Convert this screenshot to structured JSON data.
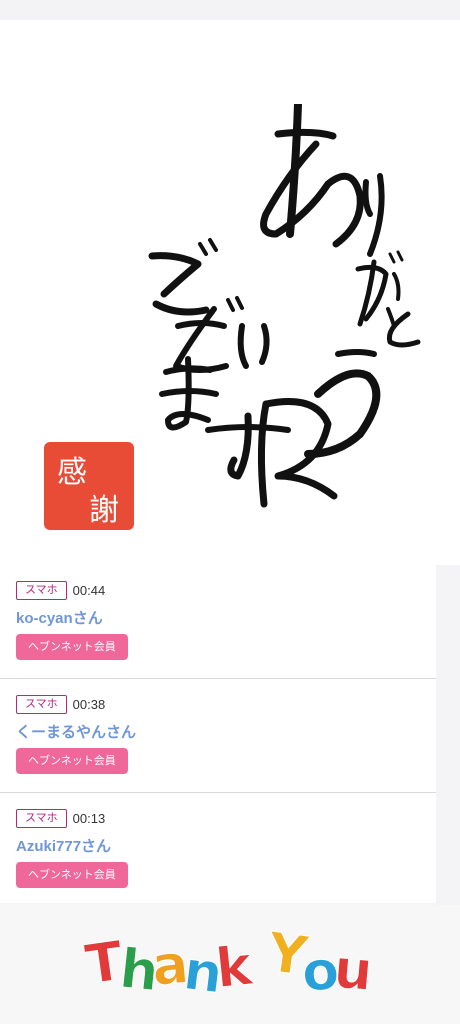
{
  "hero": {
    "message_text": "ありがとうございます",
    "seal_text": "感謝"
  },
  "visitors": [
    {
      "device": "スマホ",
      "time": "00:44",
      "name": "ko-cyanさん",
      "member_type": "ヘブンネット会員"
    },
    {
      "device": "スマホ",
      "time": "00:38",
      "name": "くーまるやんさん",
      "member_type": "ヘブンネット会員"
    },
    {
      "device": "スマホ",
      "time": "00:13",
      "name": "Azuki777さん",
      "member_type": "ヘブンネット会員"
    }
  ],
  "footer": {
    "banner_text": "Thank You",
    "letter_colors": [
      "#e03a3a",
      "#2a9e4a",
      "#f0a020",
      "#2aa0d8",
      "#e03a3a",
      "#f0b020",
      "#2aa0d8",
      "#e03a3a"
    ]
  }
}
